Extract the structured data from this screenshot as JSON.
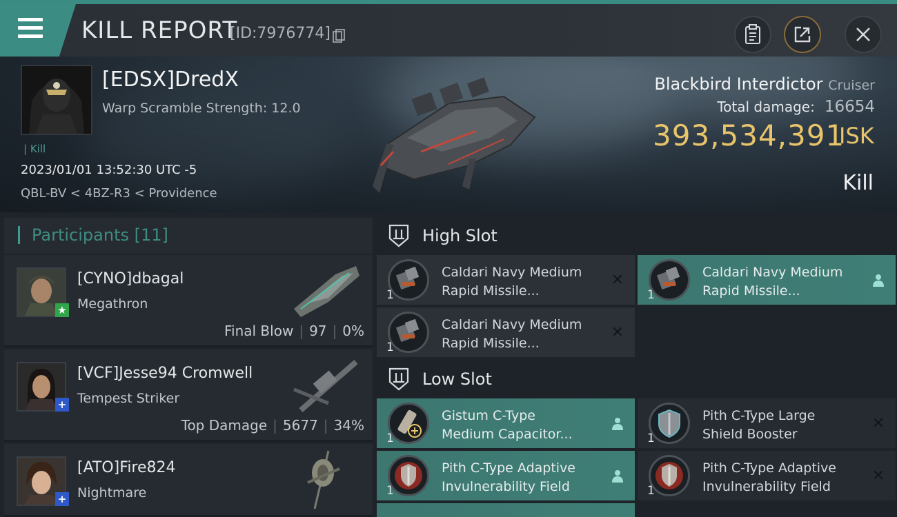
{
  "header": {
    "title": "KILL REPORT",
    "report_id": "[ID:7976774]"
  },
  "victim": {
    "name": "[EDSX]DredX",
    "warp_scramble": "Warp Scramble Strength: 12.0",
    "kill_tag": "Kill",
    "datetime": "2023/01/01 13:52:30 UTC -5",
    "location": "QBL-BV < 4BZ-R3 < Providence",
    "ship": "Blackbird Interdictor",
    "ship_class": "Cruiser",
    "total_damage_label": "Total damage:",
    "total_damage": "16654",
    "isk_value": "393,534,391",
    "isk_unit": "ISK",
    "result": "Kill"
  },
  "participants": {
    "title": "Participants",
    "count": "[11]",
    "items": [
      {
        "name": "[CYNO]dbagal",
        "ship": "Megathron",
        "tag": "Final Blow",
        "damage": "97",
        "percent": "0%",
        "badge": "★",
        "badge_color": "#2fa64a"
      },
      {
        "name": "[VCF]Jesse94 Cromwell",
        "ship": "Tempest Striker",
        "tag": "Top Damage",
        "damage": "5677",
        "percent": "34%",
        "badge": "+",
        "badge_color": "#2f58c8"
      },
      {
        "name": "[ATO]Fire824",
        "ship": "Nightmare",
        "tag": "",
        "damage": "",
        "percent": "",
        "badge": "+",
        "badge_color": "#2f58c8"
      }
    ]
  },
  "fitting": {
    "high_slot_label": "High Slot",
    "low_slot_label": "Low Slot",
    "high": [
      {
        "qty": "1",
        "line1": "Caldari Navy Medium",
        "line2": "Rapid Missile...",
        "status": "destroyed",
        "icon": "missile-launcher-icon"
      },
      {
        "qty": "1",
        "line1": "Caldari Navy Medium",
        "line2": "Rapid Missile...",
        "status": "dropped",
        "icon": "missile-launcher-icon"
      },
      {
        "qty": "1",
        "line1": "Caldari Navy Medium",
        "line2": "Rapid Missile...",
        "status": "destroyed",
        "icon": "missile-launcher-icon"
      }
    ],
    "low": [
      {
        "qty": "1",
        "line1": "Gistum C-Type",
        "line2": "Medium Capacitor...",
        "status": "dropped",
        "icon": "capacitor-battery-icon"
      },
      {
        "qty": "1",
        "line1": "Pith C-Type Large",
        "line2": "Shield Booster",
        "status": "destroyed",
        "icon": "shield-booster-icon"
      },
      {
        "qty": "1",
        "line1": "Pith C-Type Adaptive",
        "line2": "Invulnerability Field",
        "status": "dropped",
        "icon": "invulnerability-field-icon"
      },
      {
        "qty": "1",
        "line1": "Pith C-Type Adaptive",
        "line2": "Invulnerability Field",
        "status": "destroyed",
        "icon": "invulnerability-field-icon"
      }
    ]
  }
}
